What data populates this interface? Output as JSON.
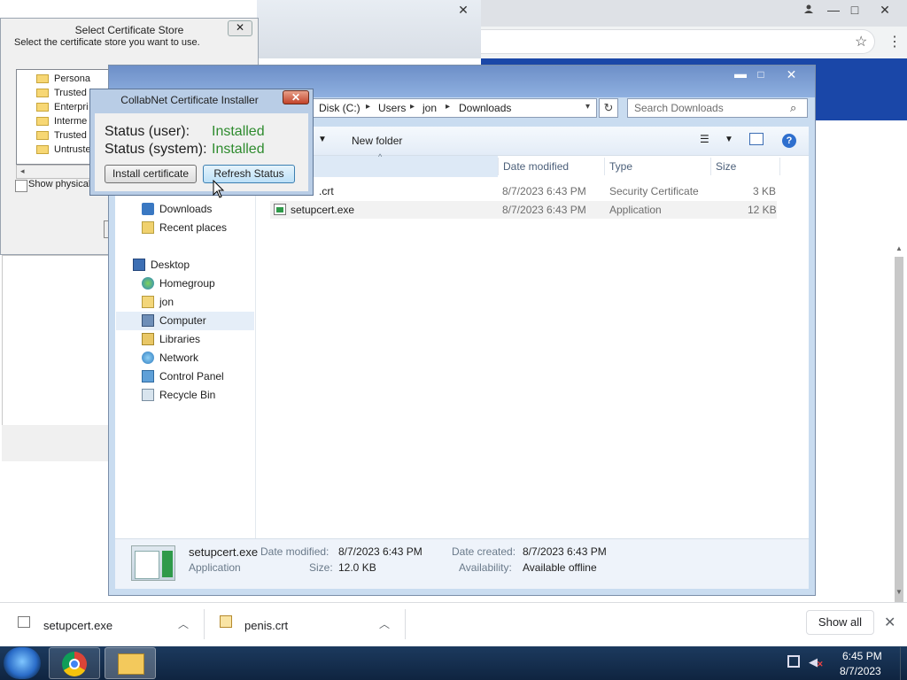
{
  "chrome": {
    "minimize": "—",
    "maximize": "□",
    "close": "✕",
    "bookmark_icon": "star-icon",
    "menu_icon": "kebab-menu-icon"
  },
  "cert_store_dialog": {
    "title": "Select Certificate Store",
    "close": "✕",
    "prompt": "Select the certificate store you want to use.",
    "tree_items": [
      "Persona",
      "Trusted",
      "Enterpri",
      "Interme",
      "Trusted",
      "Untruste"
    ],
    "show_physical_label": "Show physical stor"
  },
  "installer_dialog": {
    "title": "CollabNet Certificate Installer",
    "close": "✕",
    "status_user_label": "Status (user):",
    "status_user_value": "Installed",
    "status_system_label": "Status (system):",
    "status_system_value": "Installed",
    "install_button": "Install certificate",
    "refresh_button": "Refresh Status"
  },
  "explorer": {
    "minimize": "▬",
    "maximize": "□",
    "close": "✕",
    "breadcrumb": [
      "Disk (C:)",
      "Users",
      "jon",
      "Downloads"
    ],
    "search_placeholder": "Search Downloads",
    "new_folder": "New folder",
    "columns": [
      "Date modified",
      "Type",
      "Size"
    ],
    "files": [
      {
        "name": ".crt",
        "date": "8/7/2023 6:43 PM",
        "type": "Security Certificate",
        "size": "3 KB"
      },
      {
        "name": "setupcert.exe",
        "date": "8/7/2023 6:43 PM",
        "type": "Application",
        "size": "12 KB"
      }
    ],
    "nav": {
      "favorites": [
        "Downloads",
        "Recent places"
      ],
      "desktop": "Desktop",
      "items": [
        "Homegroup",
        "jon",
        "Computer",
        "Libraries",
        "Network",
        "Control Panel",
        "Recycle Bin"
      ]
    },
    "details": {
      "name": "setupcert.exe",
      "kind": "Application",
      "date_modified_label": "Date modified:",
      "date_modified": "8/7/2023 6:43 PM",
      "size_label": "Size:",
      "size": "12.0 KB",
      "date_created_label": "Date created:",
      "date_created": "8/7/2023 6:43 PM",
      "availability_label": "Availability:",
      "availability": "Available offline"
    }
  },
  "downloads_shelf": {
    "items": [
      "setupcert.exe",
      "penis.crt"
    ],
    "show_all": "Show all",
    "close": "✕"
  },
  "taskbar": {
    "time": "6:45 PM",
    "date": "8/7/2023"
  }
}
